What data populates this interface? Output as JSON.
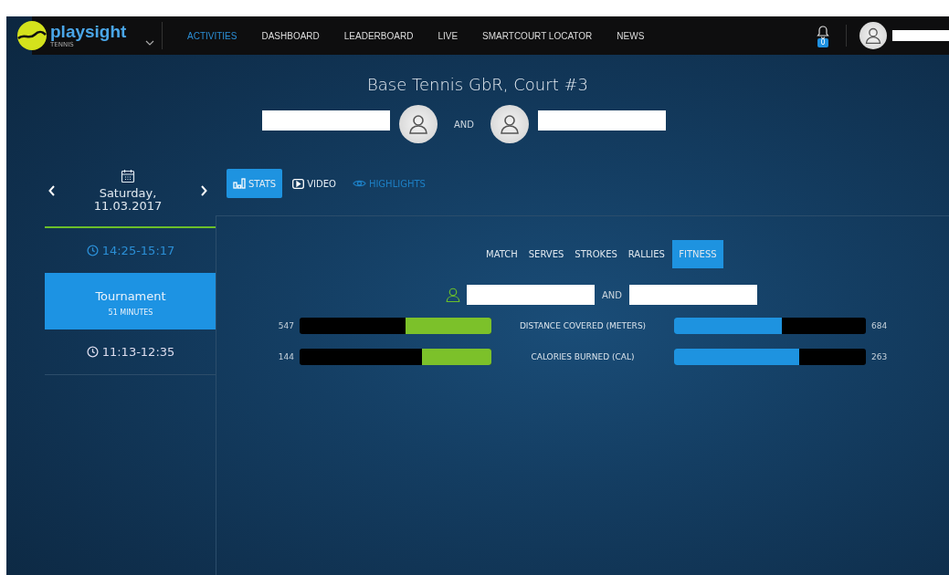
{
  "header": {
    "logo": {
      "name": "playsight",
      "sport": "TENNIS"
    },
    "nav": [
      {
        "label": "ACTIVITIES",
        "selected": true
      },
      {
        "label": "DASHBOARD",
        "selected": false
      },
      {
        "label": "LEADERBOARD",
        "selected": false
      },
      {
        "label": "LIVE",
        "selected": false
      },
      {
        "label": "SMARTCOURT LOCATOR",
        "selected": false
      },
      {
        "label": "NEWS",
        "selected": false
      }
    ],
    "notifications": "0"
  },
  "session": {
    "title": "Base Tennis GbR, Court #3",
    "joiner": "AND"
  },
  "date_nav": {
    "day": "Saturday,",
    "date": "11.03.2017"
  },
  "activities": [
    {
      "kind": "time",
      "label": "14:25-15:17",
      "selected": true
    },
    {
      "kind": "card",
      "title": "Tournament",
      "subtitle": "51 MINUTES",
      "selected": true
    },
    {
      "kind": "time",
      "label": "11:13-12:35",
      "selected": false
    }
  ],
  "view_tabs": [
    {
      "label": "STATS",
      "selected": true,
      "disabled": false
    },
    {
      "label": "VIDEO",
      "selected": false,
      "disabled": false
    },
    {
      "label": "HIGHLIGHTS",
      "selected": false,
      "disabled": true
    }
  ],
  "stat_tabs": [
    {
      "label": "MATCH",
      "selected": false
    },
    {
      "label": "SERVES",
      "selected": false
    },
    {
      "label": "STROKES",
      "selected": false
    },
    {
      "label": "RALLIES",
      "selected": false
    },
    {
      "label": "FITNESS",
      "selected": true
    }
  ],
  "players_joiner": "AND",
  "metrics": [
    {
      "label": "DISTANCE COVERED (METERS)",
      "left": {
        "value": "547",
        "level": 0.45
      },
      "right": {
        "value": "684",
        "level": 0.56
      }
    },
    {
      "label": "CALORIES BURNED (CAL)",
      "left": {
        "value": "144",
        "level": 0.36
      },
      "right": {
        "value": "263",
        "level": 0.65
      }
    }
  ]
}
